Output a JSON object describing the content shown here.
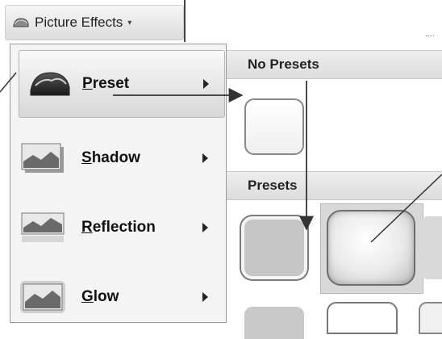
{
  "ribbon": {
    "button_label": "Picture Effects"
  },
  "menu": {
    "items": [
      {
        "accel": "P",
        "rest": "reset",
        "icon": "preset-thumbnail-icon",
        "active": true
      },
      {
        "accel": "S",
        "rest": "hadow",
        "icon": "shadow-thumbnail-icon",
        "active": false
      },
      {
        "accel": "R",
        "rest": "eflection",
        "icon": "reflection-thumbnail-icon",
        "active": false
      },
      {
        "accel": "G",
        "rest": "low",
        "icon": "glow-thumbnail-icon",
        "active": false
      }
    ]
  },
  "submenu": {
    "no_presets_header": "No Presets",
    "presets_header": "Presets"
  },
  "colors": {
    "menu_bg": "#f4f4f4",
    "highlight": "#d7d7d7",
    "callout_line": "#333333"
  }
}
